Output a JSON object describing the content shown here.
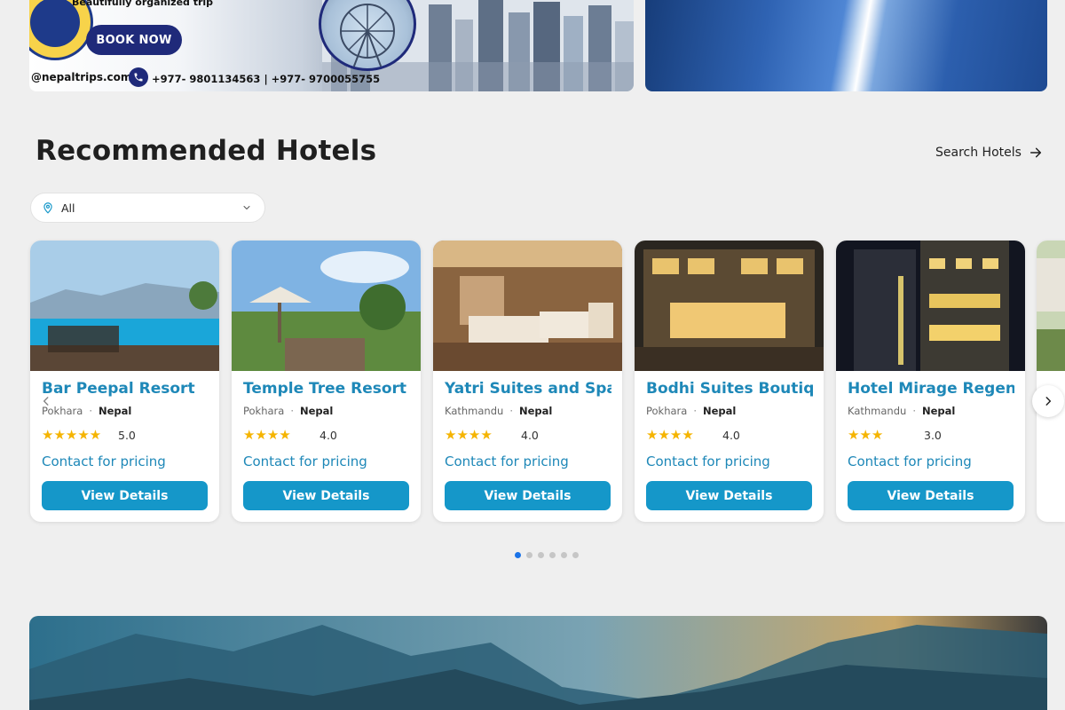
{
  "banner": {
    "tagline": "Beautifully organized trip",
    "book_now": "BOOK NOW",
    "email": "@nepaltrips.com",
    "phones": "+977- 9801134563 | +977- 9700055755"
  },
  "section": {
    "title": "Recommended Hotels",
    "search_link": "Search Hotels"
  },
  "filter": {
    "value": "All"
  },
  "hotels": [
    {
      "name": "Bar Peepal Resort",
      "city": "Pokhara",
      "country": "Nepal",
      "stars": "★★★★★",
      "score": "5.0",
      "price": "Contact for pricing",
      "button": "View Details"
    },
    {
      "name": "Temple Tree Resort & Spa",
      "city": "Pokhara",
      "country": "Nepal",
      "stars": "★★★★",
      "score": "4.0",
      "price": "Contact for pricing",
      "button": "View Details"
    },
    {
      "name": "Yatri Suites and Spa",
      "city": "Kathmandu",
      "country": "Nepal",
      "stars": "★★★★",
      "score": "4.0",
      "price": "Contact for pricing",
      "button": "View Details"
    },
    {
      "name": "Bodhi Suites Boutique",
      "city": "Pokhara",
      "country": "Nepal",
      "stars": "★★★★",
      "score": "4.0",
      "price": "Contact for pricing",
      "button": "View Details"
    },
    {
      "name": "Hotel Mirage Regency",
      "city": "Kathmandu",
      "country": "Nepal",
      "stars": "★★★",
      "score": "3.0",
      "price": "Contact for pricing",
      "button": "View Details"
    }
  ],
  "pagination": {
    "active": 1,
    "total": 6
  },
  "colors": {
    "accent": "#1597c9",
    "title": "#1e88b8",
    "star": "#f5b400",
    "dot_active": "#1a73e8"
  }
}
